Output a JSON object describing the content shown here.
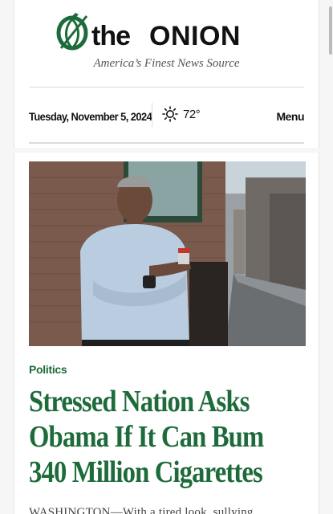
{
  "header": {
    "logo_text": "the ONION",
    "tagline": "America’s Finest News Source",
    "date": "Tuesday, November 5, 2024",
    "temperature": "72°",
    "weather_icon": "sun-icon",
    "menu_label": "Menu"
  },
  "article": {
    "category": "Politics",
    "headline": "Stressed Nation Asks Obama If It Can Bum 340 Million Cigarettes",
    "lead_snippet": "WASHINGTON—With a tired look, sullying",
    "hero_image": "photo-of-man-in-blue-shirt-holding-cigarette-pack-in-alley"
  },
  "colors": {
    "brand_green": "#1d6b3a",
    "logo_black": "#111111"
  }
}
